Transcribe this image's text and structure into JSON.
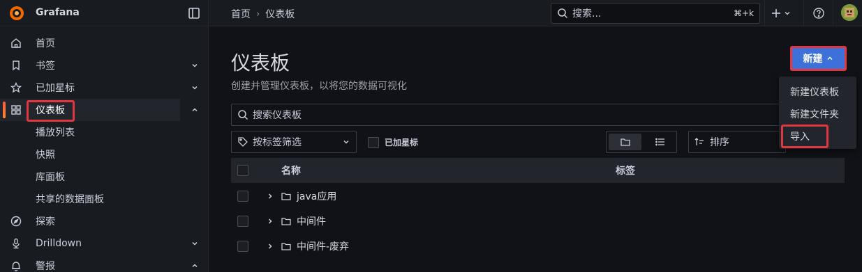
{
  "app": {
    "name": "Grafana"
  },
  "breadcrumb": {
    "home": "首页",
    "current": "仪表板"
  },
  "search": {
    "placeholder": "搜索...",
    "shortcut": "⌘+k"
  },
  "sidebar": {
    "items": [
      {
        "label": "首页",
        "icon": "home-icon"
      },
      {
        "label": "书签",
        "icon": "bookmark-icon",
        "expandable": true
      },
      {
        "label": "已加星标",
        "icon": "star-icon",
        "expandable": true
      },
      {
        "label": "仪表板",
        "icon": "apps-icon",
        "active": true
      },
      {
        "label": "探索",
        "icon": "compass-icon"
      },
      {
        "label": "Drilldown",
        "icon": "drilldown-icon",
        "expandable": true
      },
      {
        "label": "警报",
        "icon": "bell-icon",
        "expandable": true
      }
    ],
    "subitems": [
      "播放列表",
      "快照",
      "库面板",
      "共享的数据面板"
    ]
  },
  "page": {
    "title": "仪表板",
    "subtitle": "创建并管理仪表板，以将您的数据可视化"
  },
  "new_button": {
    "label": "新建"
  },
  "new_menu": {
    "items": [
      "新建仪表板",
      "新建文件夹",
      "导入"
    ]
  },
  "filters": {
    "search_placeholder": "搜索仪表板",
    "tag_filter_placeholder": "按标签筛选",
    "starred_label": "已加星标",
    "sort_placeholder": "排序"
  },
  "table": {
    "columns": {
      "name": "名称",
      "tags": "标签"
    },
    "rows": [
      {
        "name": "java应用",
        "type": "folder"
      },
      {
        "name": "中间件",
        "type": "folder"
      },
      {
        "name": "中间件-废弃",
        "type": "folder"
      }
    ]
  },
  "colors": {
    "accent": "#3d71d9",
    "highlight": "#e0383e",
    "active_bar": "#f55f3e"
  }
}
